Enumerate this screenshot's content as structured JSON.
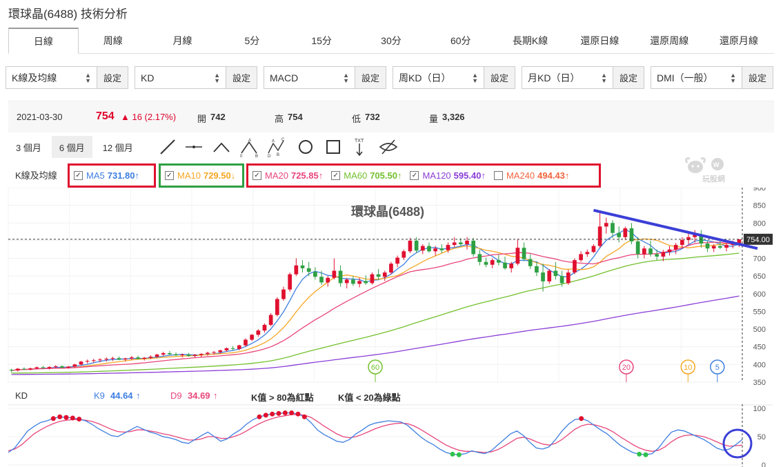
{
  "page": {
    "title": "環球晶(6488) 技術分析"
  },
  "tabs": [
    {
      "label": "日線",
      "active": true
    },
    {
      "label": "周線"
    },
    {
      "label": "月線"
    },
    {
      "label": "5分"
    },
    {
      "label": "15分"
    },
    {
      "label": "30分"
    },
    {
      "label": "60分"
    },
    {
      "label": "長期K線"
    },
    {
      "label": "還原日線"
    },
    {
      "label": "還原周線"
    },
    {
      "label": "還原月線"
    }
  ],
  "selectors": [
    {
      "value": "K線及均線",
      "button": "設定"
    },
    {
      "value": "KD",
      "button": "設定"
    },
    {
      "value": "MACD",
      "button": "設定"
    },
    {
      "value": "周KD（日）",
      "button": "設定"
    },
    {
      "value": "月KD（日）",
      "button": "設定"
    },
    {
      "value": "DMI（一般）",
      "button": "設定"
    }
  ],
  "quote": {
    "date": "2021-03-30",
    "price": "754",
    "change": "▲ 16 (2.17%)",
    "open_label": "開",
    "open": "742",
    "high_label": "高",
    "high": "754",
    "low_label": "低",
    "low": "732",
    "vol_label": "量",
    "vol": "3,326"
  },
  "periods": [
    {
      "label": "3 個月"
    },
    {
      "label": "6 個月",
      "active": true
    },
    {
      "label": "12 個月"
    }
  ],
  "tools": [
    "line-tool-icon",
    "horizontal-line-tool-icon",
    "angle-tool-icon",
    "abc-pattern-icon",
    "abcd-pattern-icon",
    "circle-tool-icon",
    "rectangle-tool-icon",
    "text-tool-icon",
    "hide-drawings-icon"
  ],
  "watermark": {
    "text": "玩股網"
  },
  "ma": {
    "label": "K線及均線",
    "items": [
      {
        "name": "MA5",
        "value": "731.80",
        "arrow": "↑",
        "checked": true,
        "color": "#3d7ee0"
      },
      {
        "name": "MA10",
        "value": "729.50",
        "arrow": "↓",
        "checked": true,
        "color": "#f5a623"
      },
      {
        "name": "MA20",
        "value": "725.85",
        "arrow": "↑",
        "checked": true,
        "color": "#e8457a"
      },
      {
        "name": "MA60",
        "value": "705.50",
        "arrow": "↑",
        "checked": true,
        "color": "#72c02c"
      },
      {
        "name": "MA120",
        "value": "595.40",
        "arrow": "↑",
        "checked": true,
        "color": "#8a3dd6"
      },
      {
        "name": "MA240",
        "value": "494.43",
        "arrow": "↑",
        "checked": false,
        "color": "#f0643c"
      }
    ]
  },
  "chart_data": {
    "type": "candlestick",
    "title": "環球晶(6488)",
    "ylim": [
      350,
      900
    ],
    "yticks": [
      350,
      400,
      450,
      500,
      550,
      600,
      650,
      700,
      750,
      800,
      850,
      900
    ],
    "last_price_label": "754.00",
    "last_price": 754,
    "ma_markers": [
      {
        "label": "60",
        "color": "#72c02c"
      },
      {
        "label": "20",
        "color": "#e8457a"
      },
      {
        "label": "10",
        "color": "#f5a623"
      },
      {
        "label": "5",
        "color": "#3d7ee0"
      }
    ],
    "candles": [
      [
        385,
        388,
        378,
        383
      ],
      [
        383,
        390,
        380,
        388
      ],
      [
        388,
        392,
        384,
        386
      ],
      [
        386,
        391,
        383,
        389
      ],
      [
        389,
        394,
        386,
        392
      ],
      [
        392,
        396,
        388,
        390
      ],
      [
        390,
        395,
        386,
        393
      ],
      [
        393,
        398,
        390,
        395
      ],
      [
        395,
        398,
        389,
        391
      ],
      [
        391,
        396,
        388,
        394
      ],
      [
        394,
        402,
        392,
        400
      ],
      [
        400,
        410,
        398,
        408
      ],
      [
        408,
        414,
        403,
        410
      ],
      [
        410,
        416,
        405,
        412
      ],
      [
        412,
        418,
        406,
        414
      ],
      [
        414,
        420,
        408,
        416
      ],
      [
        416,
        422,
        410,
        418
      ],
      [
        418,
        423,
        412,
        414
      ],
      [
        414,
        419,
        409,
        417
      ],
      [
        417,
        424,
        413,
        420
      ],
      [
        420,
        425,
        414,
        416
      ],
      [
        416,
        421,
        411,
        419
      ],
      [
        419,
        426,
        415,
        422
      ],
      [
        422,
        430,
        418,
        428
      ],
      [
        428,
        436,
        424,
        432
      ],
      [
        432,
        438,
        426,
        429
      ],
      [
        429,
        434,
        423,
        426
      ],
      [
        426,
        431,
        420,
        428
      ],
      [
        428,
        433,
        422,
        424
      ],
      [
        424,
        430,
        419,
        427
      ],
      [
        427,
        432,
        421,
        430
      ],
      [
        430,
        436,
        425,
        433
      ],
      [
        433,
        438,
        427,
        435
      ],
      [
        435,
        442,
        430,
        440
      ],
      [
        440,
        448,
        436,
        446
      ],
      [
        446,
        452,
        440,
        444
      ],
      [
        444,
        456,
        440,
        454
      ],
      [
        454,
        474,
        450,
        470
      ],
      [
        470,
        486,
        466,
        484
      ],
      [
        484,
        500,
        478,
        496
      ],
      [
        496,
        516,
        490,
        512
      ],
      [
        512,
        545,
        508,
        540
      ],
      [
        540,
        590,
        536,
        585
      ],
      [
        585,
        620,
        580,
        612
      ],
      [
        612,
        660,
        606,
        655
      ],
      [
        655,
        700,
        650,
        680
      ],
      [
        680,
        695,
        660,
        672
      ],
      [
        672,
        690,
        650,
        662
      ],
      [
        662,
        675,
        640,
        648
      ],
      [
        648,
        665,
        625,
        632
      ],
      [
        632,
        650,
        620,
        645
      ],
      [
        645,
        700,
        640,
        665
      ],
      [
        665,
        680,
        620,
        630
      ],
      [
        630,
        645,
        615,
        640
      ],
      [
        640,
        650,
        622,
        628
      ],
      [
        628,
        645,
        618,
        636
      ],
      [
        636,
        652,
        625,
        630
      ],
      [
        630,
        660,
        626,
        655
      ],
      [
        655,
        670,
        640,
        648
      ],
      [
        648,
        665,
        636,
        660
      ],
      [
        660,
        690,
        655,
        685
      ],
      [
        685,
        708,
        675,
        702
      ],
      [
        702,
        725,
        695,
        720
      ],
      [
        720,
        758,
        715,
        750
      ],
      [
        750,
        760,
        715,
        722
      ],
      [
        722,
        740,
        712,
        735
      ],
      [
        735,
        745,
        716,
        720
      ],
      [
        720,
        735,
        708,
        728
      ],
      [
        728,
        740,
        715,
        723
      ],
      [
        723,
        745,
        716,
        738
      ],
      [
        738,
        760,
        732,
        745
      ],
      [
        745,
        757,
        735,
        740
      ],
      [
        740,
        760,
        725,
        750
      ],
      [
        750,
        758,
        705,
        712
      ],
      [
        712,
        724,
        680,
        690
      ],
      [
        690,
        702,
        675,
        682
      ],
      [
        682,
        700,
        672,
        695
      ],
      [
        695,
        710,
        680,
        688
      ],
      [
        688,
        705,
        668,
        672
      ],
      [
        672,
        690,
        660,
        685
      ],
      [
        685,
        755,
        680,
        730
      ],
      [
        730,
        745,
        692,
        698
      ],
      [
        698,
        712,
        670,
        678
      ],
      [
        678,
        690,
        650,
        660
      ],
      [
        660,
        685,
        606,
        635
      ],
      [
        635,
        670,
        628,
        665
      ],
      [
        665,
        690,
        640,
        650
      ],
      [
        650,
        665,
        620,
        630
      ],
      [
        630,
        668,
        625,
        660
      ],
      [
        660,
        700,
        655,
        695
      ],
      [
        695,
        720,
        690,
        712
      ],
      [
        712,
        725,
        704,
        718
      ],
      [
        718,
        740,
        715,
        735
      ],
      [
        735,
        835,
        730,
        790
      ],
      [
        790,
        815,
        770,
        800
      ],
      [
        800,
        808,
        758,
        772
      ],
      [
        772,
        790,
        745,
        760
      ],
      [
        760,
        790,
        752,
        785
      ],
      [
        785,
        800,
        740,
        748
      ],
      [
        748,
        760,
        700,
        712
      ],
      [
        712,
        735,
        700,
        728
      ],
      [
        728,
        750,
        705,
        712
      ],
      [
        712,
        725,
        695,
        705
      ],
      [
        705,
        724,
        692,
        718
      ],
      [
        718,
        735,
        708,
        725
      ],
      [
        725,
        744,
        712,
        738
      ],
      [
        738,
        760,
        730,
        752
      ],
      [
        752,
        772,
        740,
        760
      ],
      [
        760,
        780,
        745,
        768
      ],
      [
        768,
        780,
        730,
        742
      ],
      [
        742,
        750,
        718,
        728
      ],
      [
        728,
        740,
        718,
        735
      ],
      [
        735,
        748,
        726,
        730
      ],
      [
        730,
        742,
        720,
        738
      ],
      [
        738,
        750,
        728,
        742
      ],
      [
        742,
        754,
        732,
        754
      ]
    ],
    "k9_label": "K9",
    "k9_value": "44.64",
    "k9_arrow": "↑",
    "k9_color": "#3d7ee0",
    "d9_label": "D9",
    "d9_value": "34.69",
    "d9_arrow": "↑",
    "d9_color": "#e8457a",
    "kd_note1": "K值 > 80為紅點",
    "kd_note2": "K值 < 20為綠點",
    "kd_label": "KD",
    "kd_ylim": [
      0,
      100
    ],
    "kd_yticks": [
      0,
      50,
      100
    ],
    "k": [
      22,
      30,
      45,
      60,
      68,
      75,
      78,
      82,
      85,
      84,
      83,
      81,
      78,
      72,
      64,
      58,
      52,
      50,
      56,
      62,
      68,
      63,
      58,
      55,
      50,
      48,
      45,
      40,
      38,
      45,
      52,
      58,
      50,
      42,
      46,
      55,
      62,
      72,
      80,
      85,
      88,
      90,
      91,
      92,
      92,
      90,
      85,
      75,
      62,
      54,
      48,
      42,
      40,
      45,
      55,
      62,
      70,
      74,
      76,
      78,
      77,
      76,
      70,
      60,
      50,
      42,
      36,
      28,
      22,
      19,
      18,
      20,
      25,
      22,
      20,
      25,
      35,
      45,
      55,
      60,
      52,
      40,
      30,
      28,
      32,
      45,
      60,
      72,
      80,
      82,
      78,
      70,
      62,
      55,
      45,
      35,
      28,
      22,
      19,
      18,
      20,
      30,
      45,
      58,
      62,
      60,
      55,
      50,
      45,
      38,
      30,
      26,
      28,
      36,
      45
    ],
    "d": [
      25,
      28,
      35,
      45,
      55,
      62,
      68,
      73,
      77,
      79,
      80,
      80,
      79,
      77,
      73,
      68,
      63,
      59,
      58,
      59,
      62,
      62,
      60,
      58,
      55,
      53,
      50,
      47,
      44,
      44,
      46,
      50,
      50,
      47,
      47,
      50,
      54,
      60,
      67,
      73,
      78,
      82,
      85,
      87,
      89,
      89,
      88,
      84,
      77,
      69,
      62,
      55,
      50,
      48,
      50,
      54,
      59,
      64,
      68,
      71,
      73,
      74,
      73,
      69,
      63,
      56,
      49,
      42,
      35,
      30,
      26,
      24,
      24,
      23,
      22,
      23,
      27,
      33,
      40,
      47,
      49,
      46,
      41,
      37,
      35,
      38,
      45,
      54,
      63,
      69,
      72,
      71,
      68,
      64,
      58,
      50,
      43,
      36,
      30,
      26,
      24,
      26,
      32,
      41,
      48,
      52,
      53,
      52,
      50,
      46,
      41,
      36,
      33,
      34,
      35
    ]
  }
}
